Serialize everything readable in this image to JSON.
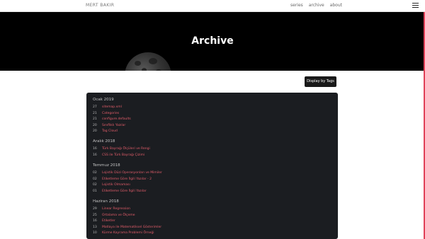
{
  "navbar": {
    "brand": "MERT BAKIR",
    "links": [
      "series",
      "archive",
      "about"
    ]
  },
  "hero": {
    "title": "Archive"
  },
  "tags_button": "Display by Tags",
  "archive": [
    {
      "month": "Ocak 2019",
      "posts": [
        {
          "day": "27",
          "title": "sitemap.xml"
        },
        {
          "day": "21",
          "title": "Categories"
        },
        {
          "day": "21",
          "title": "configure.defaults"
        },
        {
          "day": "20",
          "title": "Sınıflıklı Yazılar"
        },
        {
          "day": "20",
          "title": "Tag Cloud"
        }
      ]
    },
    {
      "month": "Aralık 2018",
      "posts": [
        {
          "day": "16",
          "title": "Türk Bayrağı Ölçüleri ve Rengi"
        },
        {
          "day": "16",
          "title": "CSS ile Türk Bayrağı Çizimi"
        }
      ]
    },
    {
      "month": "Temmuz 2018",
      "posts": [
        {
          "day": "02",
          "title": "Lojistik Düzi Operasyonları ve Mimiler"
        },
        {
          "day": "02",
          "title": "Etiketleme Göre İlgili Yazılar - 2"
        },
        {
          "day": "02",
          "title": "Lojistik Olmaması"
        },
        {
          "day": "01",
          "title": "Etiketleme Göre İlgili Yazılar"
        }
      ]
    },
    {
      "month": "Haziran 2018",
      "posts": [
        {
          "day": "29",
          "title": "Linear Regression"
        },
        {
          "day": "25",
          "title": "Ortalama ve Ölçeme"
        },
        {
          "day": "16",
          "title": "Etiketler"
        },
        {
          "day": "13",
          "title": "Matlaya ile Matematiksel Gösterimler"
        },
        {
          "day": "10",
          "title": "Kürme Kayrama Problemi Örneği"
        }
      ]
    }
  ]
}
